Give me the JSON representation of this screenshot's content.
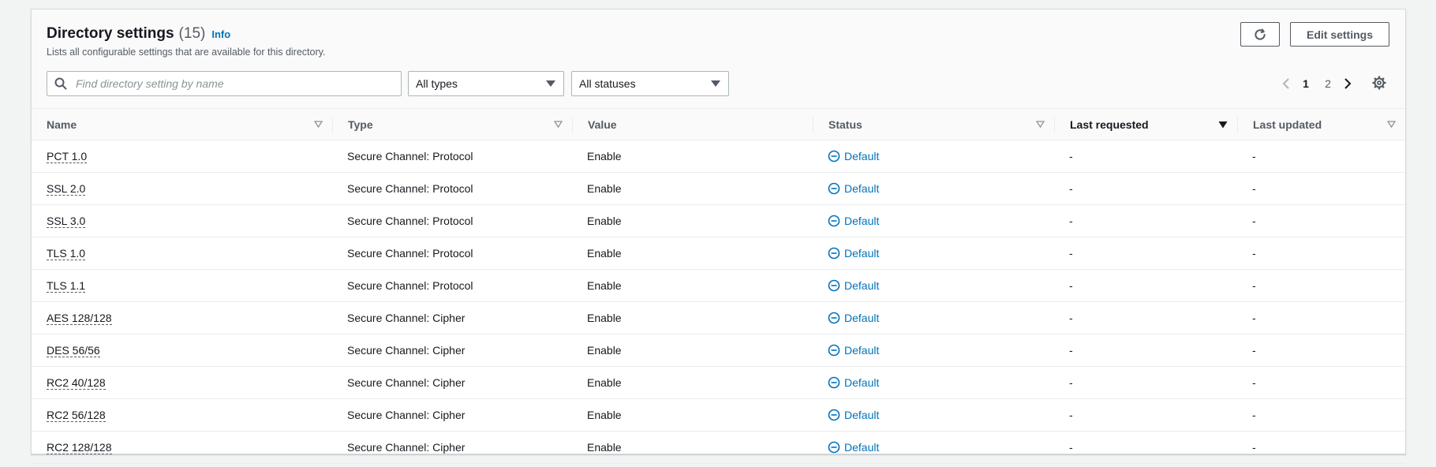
{
  "header": {
    "title": "Directory settings",
    "count": "(15)",
    "info": "Info",
    "description": "Lists all configurable settings that are available for this directory.",
    "edit_label": "Edit settings"
  },
  "filters": {
    "search_placeholder": "Find directory setting by name",
    "types_value": "All types",
    "status_value": "All statuses"
  },
  "pagination": {
    "pages": [
      "1",
      "2"
    ],
    "current": "1"
  },
  "columns": {
    "name": "Name",
    "type": "Type",
    "value": "Value",
    "status": "Status",
    "last_requested": "Last requested",
    "last_updated": "Last updated"
  },
  "rows": [
    {
      "name": "PCT 1.0",
      "type": "Secure Channel: Protocol",
      "value": "Enable",
      "status": "Default",
      "last_requested": "-",
      "last_updated": "-"
    },
    {
      "name": "SSL 2.0",
      "type": "Secure Channel: Protocol",
      "value": "Enable",
      "status": "Default",
      "last_requested": "-",
      "last_updated": "-"
    },
    {
      "name": "SSL 3.0",
      "type": "Secure Channel: Protocol",
      "value": "Enable",
      "status": "Default",
      "last_requested": "-",
      "last_updated": "-"
    },
    {
      "name": "TLS 1.0",
      "type": "Secure Channel: Protocol",
      "value": "Enable",
      "status": "Default",
      "last_requested": "-",
      "last_updated": "-"
    },
    {
      "name": "TLS 1.1",
      "type": "Secure Channel: Protocol",
      "value": "Enable",
      "status": "Default",
      "last_requested": "-",
      "last_updated": "-"
    },
    {
      "name": "AES 128/128",
      "type": "Secure Channel: Cipher",
      "value": "Enable",
      "status": "Default",
      "last_requested": "-",
      "last_updated": "-"
    },
    {
      "name": "DES 56/56",
      "type": "Secure Channel: Cipher",
      "value": "Enable",
      "status": "Default",
      "last_requested": "-",
      "last_updated": "-"
    },
    {
      "name": "RC2 40/128",
      "type": "Secure Channel: Cipher",
      "value": "Enable",
      "status": "Default",
      "last_requested": "-",
      "last_updated": "-"
    },
    {
      "name": "RC2 56/128",
      "type": "Secure Channel: Cipher",
      "value": "Enable",
      "status": "Default",
      "last_requested": "-",
      "last_updated": "-"
    },
    {
      "name": "RC2 128/128",
      "type": "Secure Channel: Cipher",
      "value": "Enable",
      "status": "Default",
      "last_requested": "-",
      "last_updated": "-"
    }
  ],
  "icons": {
    "search": "search-icon",
    "refresh": "refresh-icon",
    "settings": "gear-icon",
    "status_default": "minus-circle-icon"
  },
  "colors": {
    "link": "#0073bb",
    "text": "#16191f",
    "muted": "#545b64"
  }
}
